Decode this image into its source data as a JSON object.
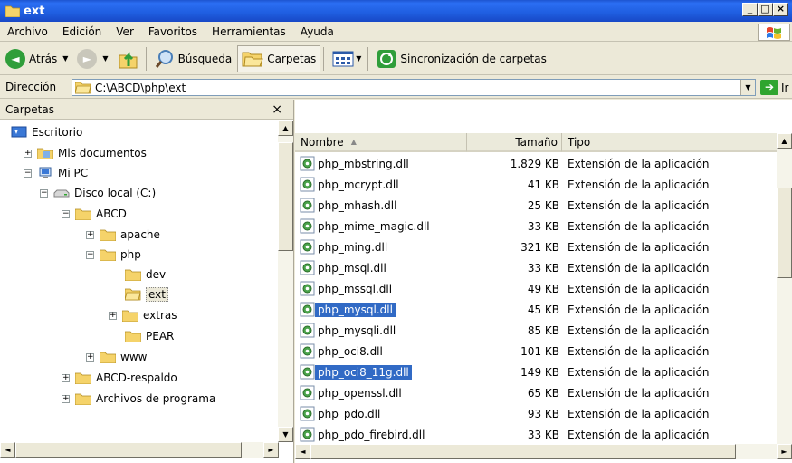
{
  "window": {
    "title": "ext",
    "min": "_",
    "max": "□",
    "close": "×"
  },
  "menu": [
    {
      "label": "Archivo"
    },
    {
      "label": "Edición"
    },
    {
      "label": "Ver"
    },
    {
      "label": "Favoritos"
    },
    {
      "label": "Herramientas"
    },
    {
      "label": "Ayuda"
    }
  ],
  "toolbar": {
    "back": "Atrás",
    "search": "Búsqueda",
    "folders": "Carpetas",
    "sync": "Sincronización de carpetas"
  },
  "address": {
    "label": "Dirección",
    "value": "C:\\ABCD\\php\\ext",
    "go": "Ir"
  },
  "folders_pane": {
    "title": "Carpetas",
    "close": "×",
    "tree": [
      {
        "label": "Escritorio",
        "expander": "",
        "icon": "desktop-icon"
      },
      {
        "label": "Mis documentos",
        "expander": "+",
        "icon": "mydocs-icon"
      },
      {
        "label": "Mi PC",
        "expander": "−",
        "icon": "mypc-icon"
      },
      {
        "label": "Disco local (C:)",
        "expander": "−",
        "icon": "disk-icon"
      },
      {
        "label": "ABCD",
        "expander": "−",
        "icon": "folder-icon"
      },
      {
        "label": "apache",
        "expander": "+",
        "icon": "folder-icon"
      },
      {
        "label": "php",
        "expander": "−",
        "icon": "folder-icon"
      },
      {
        "label": "dev",
        "expander": "",
        "icon": "folder-icon"
      },
      {
        "label": "ext",
        "expander": "",
        "icon": "folder-open-icon",
        "selected": true
      },
      {
        "label": "extras",
        "expander": "+",
        "icon": "folder-icon"
      },
      {
        "label": "PEAR",
        "expander": "",
        "icon": "folder-icon"
      },
      {
        "label": "www",
        "expander": "+",
        "icon": "folder-icon"
      },
      {
        "label": "ABCD-respaldo",
        "expander": "+",
        "icon": "folder-icon"
      },
      {
        "label": "Archivos de programa",
        "expander": "+",
        "icon": "folder-icon"
      }
    ]
  },
  "file_list": {
    "columns": {
      "name": "Nombre",
      "sort": "▲",
      "size": "Tamaño",
      "type": "Tipo"
    },
    "rows": [
      {
        "name": "php_mbstring.dll",
        "size": "1.829 KB",
        "type": "Extensión de la aplicación"
      },
      {
        "name": "php_mcrypt.dll",
        "size": "41 KB",
        "type": "Extensión de la aplicación"
      },
      {
        "name": "php_mhash.dll",
        "size": "25 KB",
        "type": "Extensión de la aplicación"
      },
      {
        "name": "php_mime_magic.dll",
        "size": "33 KB",
        "type": "Extensión de la aplicación"
      },
      {
        "name": "php_ming.dll",
        "size": "321 KB",
        "type": "Extensión de la aplicación"
      },
      {
        "name": "php_msql.dll",
        "size": "33 KB",
        "type": "Extensión de la aplicación"
      },
      {
        "name": "php_mssql.dll",
        "size": "49 KB",
        "type": "Extensión de la aplicación"
      },
      {
        "name": "php_mysql.dll",
        "size": "45 KB",
        "type": "Extensión de la aplicación",
        "selected": true
      },
      {
        "name": "php_mysqli.dll",
        "size": "85 KB",
        "type": "Extensión de la aplicación"
      },
      {
        "name": "php_oci8.dll",
        "size": "101 KB",
        "type": "Extensión de la aplicación"
      },
      {
        "name": "php_oci8_11g.dll",
        "size": "149 KB",
        "type": "Extensión de la aplicación",
        "selected": true
      },
      {
        "name": "php_openssl.dll",
        "size": "65 KB",
        "type": "Extensión de la aplicación"
      },
      {
        "name": "php_pdo.dll",
        "size": "93 KB",
        "type": "Extensión de la aplicación"
      },
      {
        "name": "php_pdo_firebird.dll",
        "size": "33 KB",
        "type": "Extensión de la aplicación"
      }
    ]
  }
}
